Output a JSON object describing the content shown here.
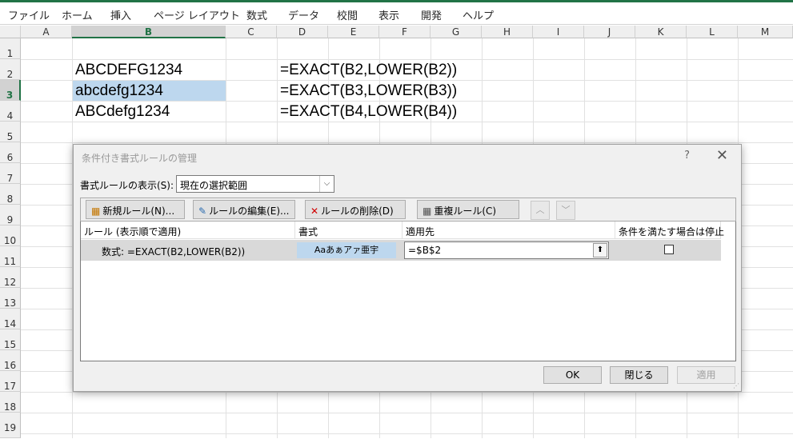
{
  "ribbon": {
    "tabs": [
      "ファイル",
      "ホーム",
      "挿入",
      "ページ レイアウト",
      "数式",
      "データ",
      "校閲",
      "表示",
      "開発",
      "ヘルプ"
    ]
  },
  "sheet": {
    "columns": [
      "A",
      "B",
      "C",
      "D",
      "E",
      "F",
      "G",
      "H",
      "I",
      "J",
      "K",
      "L",
      "M"
    ],
    "rows": [
      "1",
      "2",
      "3",
      "4",
      "5",
      "6",
      "7",
      "8",
      "9",
      "10",
      "11",
      "12",
      "13",
      "14",
      "15",
      "16",
      "17",
      "18",
      "19"
    ],
    "cells": {
      "b2": "ABCDEFG1234",
      "b3": "abcdefg1234",
      "b4": "ABCdefg1234",
      "d2": "=EXACT(B2,LOWER(B2))",
      "d3": "=EXACT(B3,LOWER(B3))",
      "d4": "=EXACT(B4,LOWER(B4))"
    }
  },
  "dialog": {
    "title": "条件付き書式ルールの管理",
    "help": "?",
    "close": "✕",
    "show_rules_label": "書式ルールの表示(S):",
    "show_rules_value": "現在の選択範囲",
    "buttons": {
      "new_rule": "新規ルール(N)...",
      "edit_rule": "ルールの編集(E)...",
      "delete_rule": "ルールの削除(D)",
      "duplicate_rule": "重複ルール(C)"
    },
    "columns": {
      "rule": "ルール (表示順で適用)",
      "format": "書式",
      "applies_to": "適用先",
      "stop_if_true": "条件を満たす場合は停止"
    },
    "rule": {
      "text": "数式: =EXACT(B2,LOWER(B2))",
      "format_preview": "Aaあぁアァ亜宇",
      "applies_to": "=$B$2",
      "stop_if_true": false
    },
    "footer": {
      "ok": "OK",
      "close": "閉じる",
      "apply": "適用"
    }
  },
  "colors": {
    "accent": "#217346",
    "selection": "#bdd7ee"
  }
}
